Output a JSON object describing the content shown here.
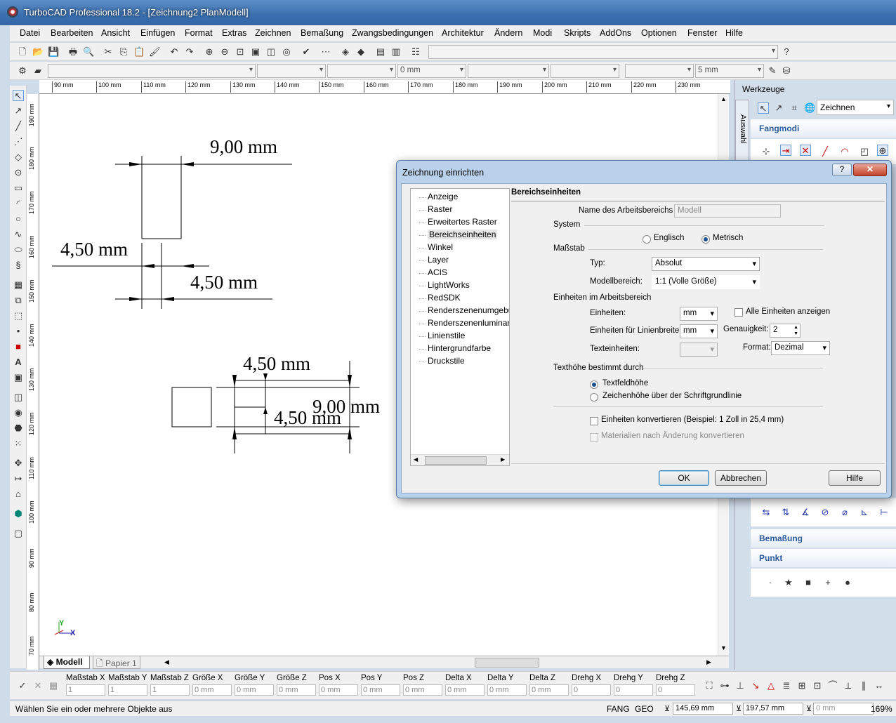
{
  "app": {
    "title": "TurboCAD Professional 18.2 - [Zeichnung2 PlanModell]"
  },
  "menu": [
    "Datei",
    "Bearbeiten",
    "Ansicht",
    "Einfügen",
    "Format",
    "Extras",
    "Zeichnen",
    "Bemaßung",
    "Zwangsbedingungen",
    "Architektur",
    "Ändern",
    "Modi",
    "Skripts",
    "AddOns",
    "Optionen",
    "Fenster",
    "Hilfe"
  ],
  "property_bar": {
    "width_combo": "0 mm",
    "size_combo": "5 mm"
  },
  "ruler": {
    "h": [
      "90 mm",
      "100 mm",
      "110 mm",
      "120 mm",
      "130 mm",
      "140 mm",
      "150 mm",
      "160 mm",
      "170 mm",
      "180 mm",
      "190 mm",
      "200 mm",
      "210 mm",
      "220 mm",
      "230 mm"
    ],
    "v": [
      "190 mm",
      "180 mm",
      "170 mm",
      "160 mm",
      "150 mm",
      "140 mm",
      "130 mm",
      "120 mm",
      "110 mm",
      "100 mm",
      "90 mm",
      "80 mm",
      "70 mm"
    ]
  },
  "drawing": {
    "dim_top": "9,00 mm",
    "dim_left": "4,50 mm",
    "dim_mid": "4,50 mm",
    "dim_b1": "4,50 mm",
    "dim_b2": "9,00 mm",
    "dim_b3": "4,50 mm"
  },
  "tabs": {
    "model": "Modell",
    "paper": "Papier 1"
  },
  "right_panel": {
    "title": "Werkzeuge",
    "vertical_tab": "Auswahl",
    "mode": "Zeichnen",
    "fangmodi": "Fangmodi",
    "bemassung": "Bemaßung",
    "punkt": "Punkt",
    "punkt_symbols": [
      "·",
      "★",
      "■",
      "+",
      "●"
    ]
  },
  "inspector": {
    "labels": [
      "Maßstab X",
      "Maßstab Y",
      "Maßstab Z",
      "Größe X",
      "Größe Y",
      "Größe Z",
      "Pos X",
      "Pos Y",
      "Pos Z",
      "Delta X",
      "Delta Y",
      "Delta Z",
      "Drehg X",
      "Drehg Y",
      "Drehg Z"
    ],
    "values": [
      "1",
      "1",
      "1",
      "0 mm",
      "0 mm",
      "0 mm",
      "0 mm",
      "0 mm",
      "0 mm",
      "0 mm",
      "0 mm",
      "0 mm",
      "0",
      "0",
      "0"
    ]
  },
  "status": {
    "message": "Wählen Sie ein oder mehrere Objekte aus",
    "fang": "FANG",
    "geo": "GEO",
    "x": "145,69 mm",
    "y": "197,57 mm",
    "z": "0 mm",
    "zoom": "169%"
  },
  "dialog": {
    "title": "Zeichnung einrichten",
    "tree": [
      "Anzeige",
      "Raster",
      "Erweitertes Raster",
      "Bereichseinheiten",
      "Winkel",
      "Layer",
      "ACIS",
      "LightWorks",
      "RedSDK",
      "Renderszenenumgebung",
      "Renderszenenluminanz",
      "Linienstile",
      "Hintergrundfarbe",
      "Druckstile"
    ],
    "selected": "Bereichseinheiten",
    "section": "Bereichseinheiten",
    "name_label": "Name des Arbeitsbereichs",
    "name_value": "Modell",
    "system_label": "System",
    "englisch": "Englisch",
    "metrisch": "Metrisch",
    "massstab_label": "Maßstab",
    "typ_label": "Typ:",
    "typ_value": "Absolut",
    "modell_label": "Modellbereich:",
    "modell_value": "1:1 (Volle Größe)",
    "einheiten_group": "Einheiten im Arbeitsbereich",
    "einheiten_label": "Einheiten:",
    "einheiten_value": "mm",
    "alle_label": "Alle Einheiten anzeigen",
    "linienbreite_label": "Einheiten für Linienbreite:",
    "linienbreite_value": "mm",
    "genauigkeit_label": "Genauigkeit:",
    "genauigkeit_value": "2",
    "text_label": "Texteinheiten:",
    "format_label": "Format:",
    "format_value": "Dezimal",
    "texthoehe_label": "Texthöhe bestimmt durch",
    "textfeld": "Textfeldhöhe",
    "zeichenhoehe": "Zeichenhöhe über der Schriftgrundlinie",
    "konvertieren": "Einheiten konvertieren (Beispiel: 1 Zoll in 25,4 mm)",
    "materialien": "Materialien nach Änderung konvertieren",
    "ok": "OK",
    "abbrechen": "Abbrechen",
    "hilfe": "Hilfe",
    "help_btn": "?",
    "close_btn": "✕"
  }
}
